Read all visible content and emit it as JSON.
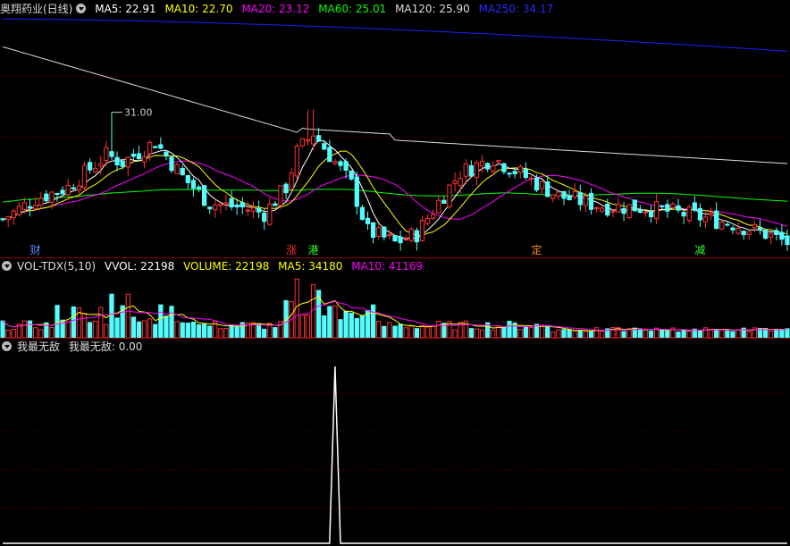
{
  "colors": {
    "up": "#ff3232",
    "down": "#54fcfc",
    "ma5": "#ffffff",
    "ma10": "#ffff00",
    "ma20": "#ff00ff",
    "ma60": "#00ff00",
    "ma120": "#dddddd",
    "ma250": "#2020ff",
    "grid": "#7a0000",
    "text": "#cccccc"
  },
  "main_legend": {
    "title": "奥翔药业(日线)",
    "ma5": "MA5: 22.91",
    "ma10": "MA10: 22.70",
    "ma20": "MA20: 23.12",
    "ma60": "MA60: 25.01",
    "ma120": "MA120: 25.90",
    "ma250": "MA250: 34.17"
  },
  "vol_legend": {
    "name": "VOL-TDX(5,10)",
    "vvol": "VVOL: 22198",
    "volume": "VOLUME: 22198",
    "ma5": "MA5: 34180",
    "ma10": "MA10: 41169"
  },
  "ind_legend": {
    "name": "我最无敌",
    "value": "我最无敌: 0.00"
  },
  "markers": [
    {
      "label": "财",
      "index": 6,
      "color": "#5a8cff"
    },
    {
      "label": "涨",
      "index": 53,
      "color": "#ff3030"
    },
    {
      "label": "港",
      "index": 57,
      "color": "#30ff30"
    },
    {
      "label": "定",
      "index": 98,
      "color": "#ff8c1a"
    },
    {
      "label": "减",
      "index": 128,
      "color": "#30ff30"
    }
  ],
  "chart_data": [
    {
      "type": "candlestick",
      "y_range": [
        19.0,
        35.5
      ],
      "high_label": "31.00",
      "high_index": 20,
      "ohlc": [],
      "ma_series": [
        "MA5",
        "MA10",
        "MA20",
        "MA60",
        "MA120",
        "MA250"
      ]
    },
    {
      "type": "bar",
      "name": "VOLUME",
      "y_range": [
        0,
        165000
      ],
      "values": [],
      "ma_series": [
        "MA5",
        "MA10"
      ]
    },
    {
      "type": "line",
      "name": "我最无敌",
      "y_range": [
        0,
        1
      ],
      "spike_index": 61,
      "values": []
    }
  ]
}
